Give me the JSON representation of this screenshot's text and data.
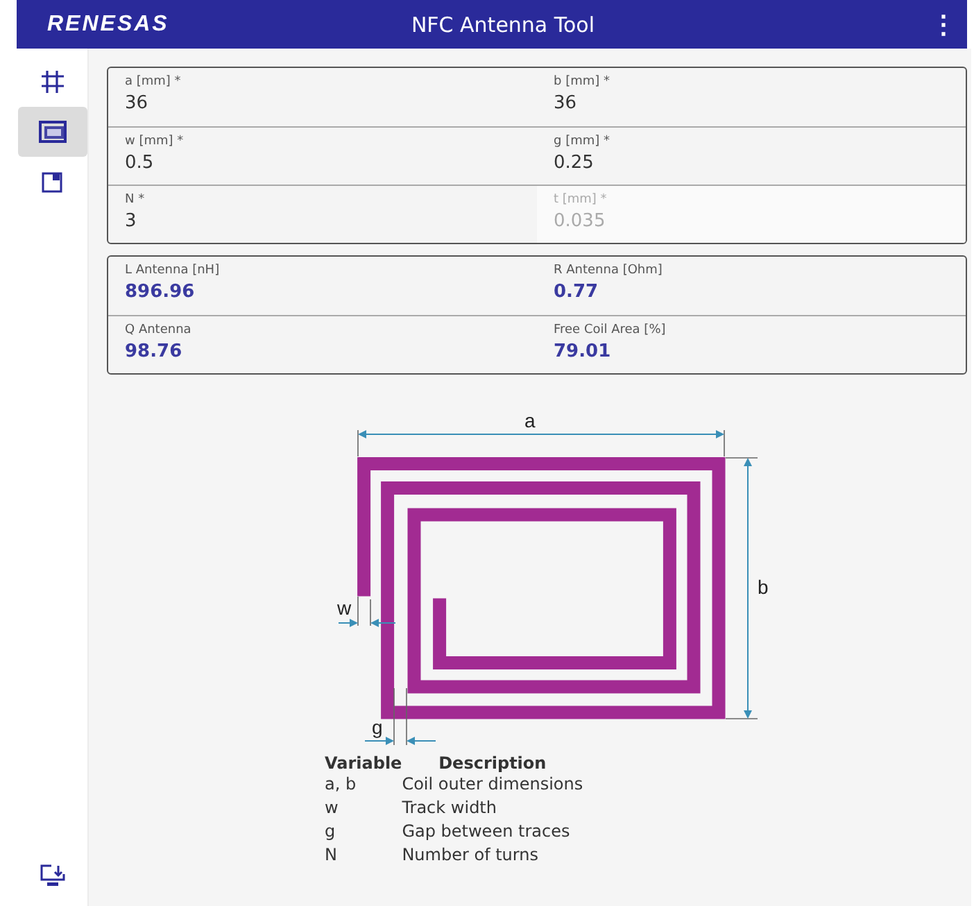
{
  "header": {
    "logo": "RENESAS",
    "title": "NFC Antenna Tool",
    "menu": "⋮"
  },
  "sidebar": {
    "items": [
      {
        "kind": "grid",
        "selected": false
      },
      {
        "kind": "window",
        "selected": true
      },
      {
        "kind": "square",
        "selected": false
      }
    ],
    "bottom_items": [
      {
        "kind": "download",
        "selected": false
      }
    ]
  },
  "inputs": [
    {
      "label": "a [mm] *",
      "value": "36",
      "disabled": false
    },
    {
      "label": "b [mm] *",
      "value": "36",
      "disabled": false
    },
    {
      "label": "w [mm] *",
      "value": "0.5",
      "disabled": false
    },
    {
      "label": "g [mm] *",
      "value": "0.25",
      "disabled": false
    },
    {
      "label": "N *",
      "value": "3",
      "disabled": false
    },
    {
      "label": "t [mm] *",
      "value": "0.035",
      "disabled": true
    }
  ],
  "results": [
    {
      "label": "L Antenna [nH]",
      "value": "896.96"
    },
    {
      "label": "R Antenna [Ohm]",
      "value": "0.77"
    },
    {
      "label": "Q Antenna",
      "value": "98.76"
    },
    {
      "label": "Free Coil Area [%]",
      "value": "79.01"
    }
  ],
  "diagram": {
    "labels": {
      "a": "a",
      "b": "b",
      "w": "w",
      "g": "g"
    }
  },
  "legend": {
    "columns": [
      "Variable",
      "Description"
    ],
    "rows": [
      [
        "a, b",
        "Coil outer dimensions"
      ],
      [
        "w",
        "Track width"
      ],
      [
        "g",
        "Gap between traces"
      ],
      [
        "N",
        "Number of turns"
      ]
    ]
  }
}
